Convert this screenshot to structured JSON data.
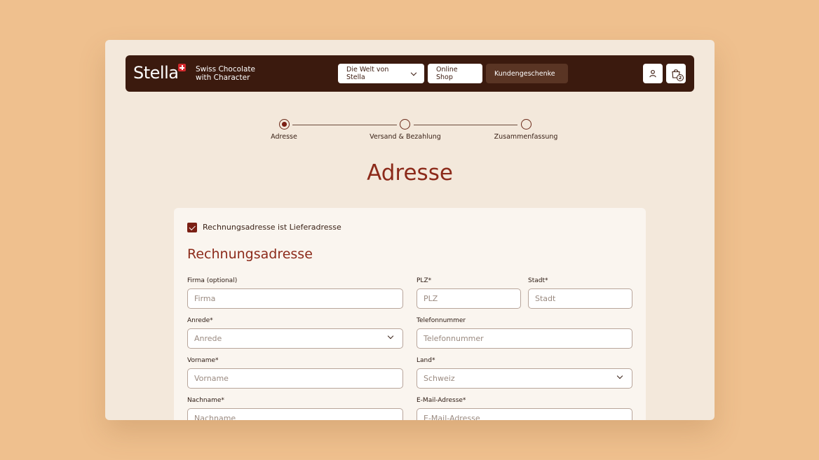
{
  "brand": {
    "logo_text": "Stella",
    "tagline_line1": "Swiss Chocolate",
    "tagline_line2": "with Character"
  },
  "nav": {
    "welt_label": "Die Welt von Stella",
    "shop_label": "Online Shop",
    "gifts_label": "Kundengeschenke",
    "cart_count": "2"
  },
  "stepper": {
    "steps": [
      {
        "label": "Adresse",
        "active": true
      },
      {
        "label": "Versand & Bezahlung",
        "active": false
      },
      {
        "label": "Zusammenfassung",
        "active": false
      }
    ]
  },
  "page": {
    "title": "Adresse"
  },
  "form": {
    "same_address_label": "Rechnungsadresse ist Lieferadresse",
    "same_address_checked": true,
    "section_title": "Rechnungsadresse",
    "fields": {
      "firma": {
        "label": "Firma (optional)",
        "placeholder": "Firma"
      },
      "plz": {
        "label": "PLZ*",
        "placeholder": "PLZ"
      },
      "stadt": {
        "label": "Stadt*",
        "placeholder": "Stadt"
      },
      "anrede": {
        "label": "Anrede*",
        "placeholder": "Anrede"
      },
      "telefon": {
        "label": "Telefonnummer",
        "placeholder": "Telefonnummer"
      },
      "vorname": {
        "label": "Vorname*",
        "placeholder": "Vorname"
      },
      "land": {
        "label": "Land*",
        "value": "Schweiz"
      },
      "nachname": {
        "label": "Nachname*",
        "placeholder": "Nachname"
      },
      "email": {
        "label": "E-Mail-Adresse*",
        "placeholder": "E-Mail-Adresse"
      }
    }
  },
  "colors": {
    "background": "#efc08e",
    "header": "#3b1a0e",
    "accent": "#8c2a1a"
  }
}
